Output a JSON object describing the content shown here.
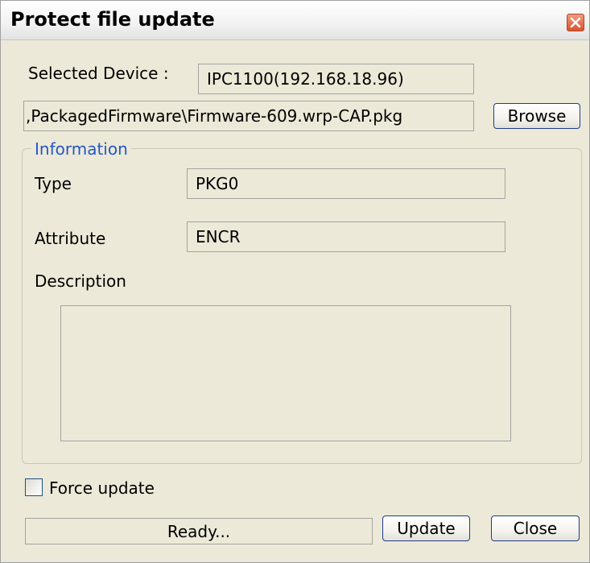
{
  "window": {
    "title": "Protect file update"
  },
  "device": {
    "label": "Selected Device :",
    "value": "IPC1100(192.168.18.96)"
  },
  "file": {
    "path": ",PackagedFirmware\\Firmware-609.wrp-CAP.pkg",
    "browse_label": "Browse"
  },
  "information": {
    "legend": "Information",
    "type_label": "Type",
    "type_value": "PKG0",
    "attribute_label": "Attribute",
    "attribute_value": "ENCR",
    "description_label": "Description",
    "description_value": ""
  },
  "options": {
    "force_update_label": "Force update",
    "force_update_checked": false
  },
  "footer": {
    "status": "Ready...",
    "update_label": "Update",
    "close_label": "Close"
  },
  "icons": {
    "close": "close-icon"
  },
  "colors": {
    "background": "#ece9d8",
    "legend_text": "#2458c8",
    "close_button": "#d9542e",
    "button_border": "#1f3c88"
  }
}
